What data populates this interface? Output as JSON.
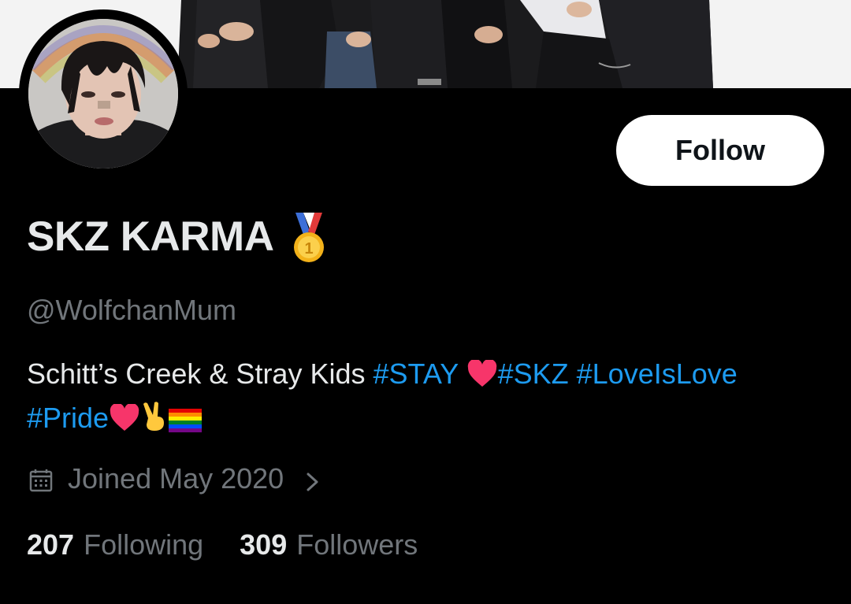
{
  "profile": {
    "display_name": "SKZ KARMA",
    "display_name_emoji": "medal-icon",
    "handle": "@WolfchanMum",
    "follow_label": "Follow",
    "bio": {
      "text1": "Schitt’s Creek & Stray Kids ",
      "tag_stay": "#STAY",
      "tag_skz": "#SKZ",
      "tag_loveislove": "#LoveIsLove",
      "tag_pride": "#Pride"
    },
    "joined": "Joined May 2020",
    "stats": {
      "following_count": "207",
      "following_label": "Following",
      "followers_count": "309",
      "followers_label": "Followers"
    }
  },
  "colors": {
    "background": "#000000",
    "text_primary": "#e7e9ea",
    "text_secondary": "#71767b",
    "link": "#1d9bf0",
    "follow_bg": "#ffffff",
    "follow_text": "#0f1419"
  },
  "icons": [
    "banner-photo",
    "avatar-photo",
    "medal-icon",
    "heart-icon",
    "victory-hand-icon",
    "rainbow-flag-icon",
    "calendar-icon",
    "chevron-right-icon"
  ]
}
